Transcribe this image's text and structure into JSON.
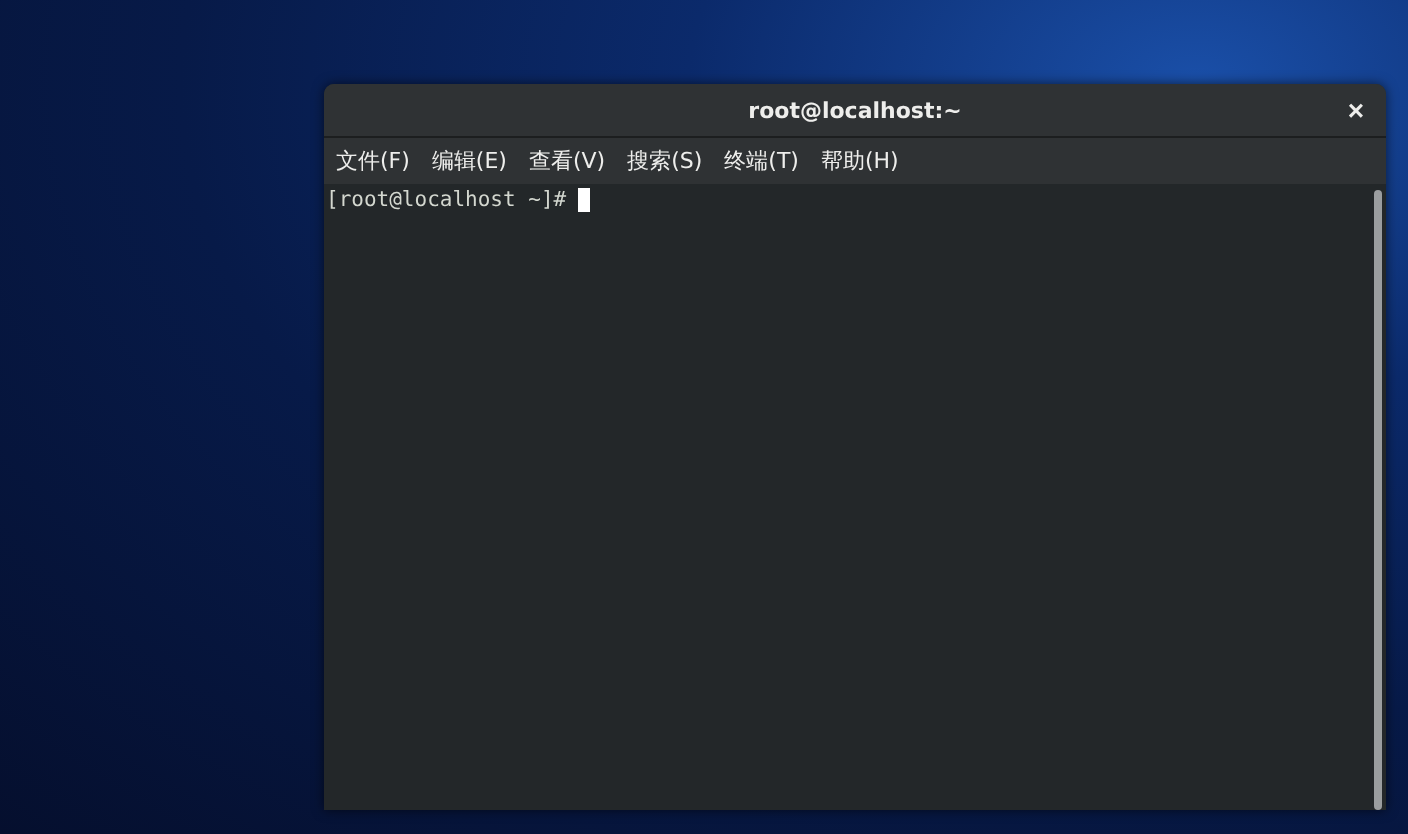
{
  "window": {
    "title": "root@localhost:~",
    "close": "×"
  },
  "menu": [
    {
      "label": "文件(F)"
    },
    {
      "label": "编辑(E)"
    },
    {
      "label": "查看(V)"
    },
    {
      "label": "搜索(S)"
    },
    {
      "label": "终端(T)"
    },
    {
      "label": "帮助(H)"
    }
  ],
  "terminal": {
    "prompt": "[root@localhost ~]#"
  }
}
